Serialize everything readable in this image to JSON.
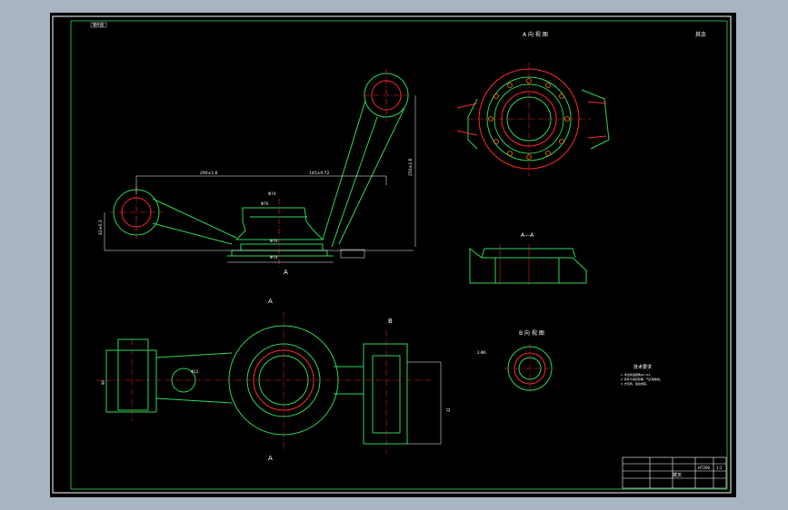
{
  "drawing": {
    "corner_label": "零件图",
    "roughness_note": "其余",
    "views": {
      "top_left": {
        "section_mark": "A",
        "dim_total": "290±1.6",
        "dim_right": "145±0.72",
        "dim_height": "250±1.6",
        "dim_left": "42±0.3",
        "dim_d1": "Φ74",
        "dim_d2": "Φ76",
        "dim_d3": "Φ74",
        "dim_d4": "Φ74"
      },
      "top_right": {
        "title": "A 向 视 图"
      },
      "middle_right": {
        "title": "A—A"
      },
      "bottom_left": {
        "section_top": "A",
        "section_bottom": "A",
        "mark_b": "B",
        "note_left": "Φ12",
        "dim_left": "90",
        "dim_right": "41"
      },
      "bottom_right_small": {
        "title": "B 向 视 图",
        "callout": "2-Φ6"
      },
      "notes": {
        "title": "技术要求",
        "lines": [
          "1. 未注铸造圆角R2~R3。",
          "2. 铸件不得有砂眼、气孔等缺陷。",
          "3. 去毛刺，锐边倒钝。"
        ]
      },
      "title_block": {
        "part_name": "拨叉",
        "material": "HT200",
        "scale": "1:1"
      }
    }
  }
}
